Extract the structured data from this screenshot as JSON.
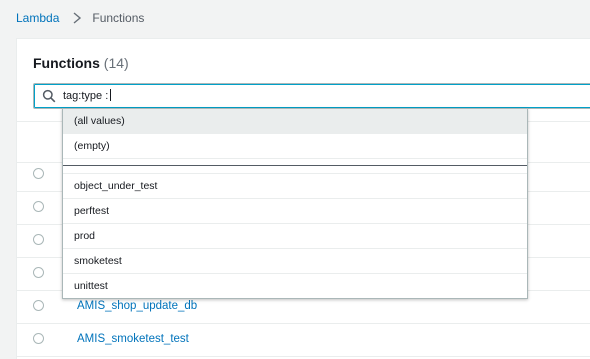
{
  "breadcrumb": {
    "root": "Lambda",
    "separator_icon": "chevron-right-icon",
    "current": "Functions"
  },
  "panel": {
    "title": "Functions",
    "count": "(14)"
  },
  "search": {
    "value": "tag:type :",
    "icon": "search-icon"
  },
  "dropdown": {
    "special_options": [
      "(all values)",
      "(empty)"
    ],
    "options": [
      "object_under_test",
      "perftest",
      "prod",
      "smoketest",
      "unittest"
    ]
  },
  "functions": [
    {
      "name": ""
    },
    {
      "name": ""
    },
    {
      "name": ""
    },
    {
      "name": ""
    },
    {
      "name": "AMIS_shop_update_db"
    },
    {
      "name": "AMIS_smoketest_test"
    }
  ]
}
